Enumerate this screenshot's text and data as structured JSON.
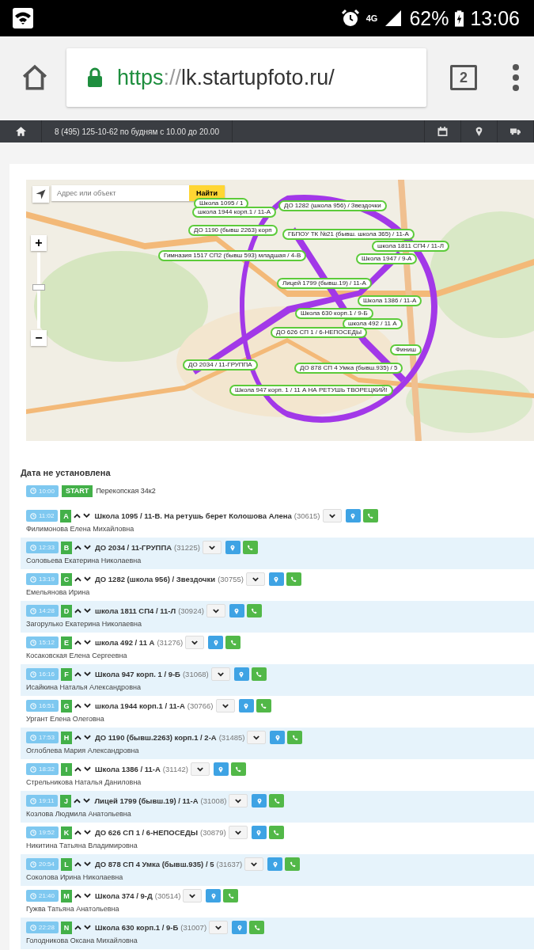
{
  "status_bar": {
    "battery": "62%",
    "time": "13:06",
    "network": "4G"
  },
  "browser": {
    "url_scheme": "https",
    "url_separator": "://",
    "url_host": "lk.startupfoto.ru/",
    "tab_count": "2"
  },
  "site_nav": {
    "phone": "8 (495) 125-10-62 по будням с 10.00 до 20.00"
  },
  "map": {
    "search": {
      "placeholder": "Адрес или объект",
      "button": "Найти"
    },
    "zoom_in": "+",
    "zoom_out": "−",
    "zoom_level": {
      "level": 0.55
    },
    "markers": [
      {
        "label": "Школа 1095 / 1"
      },
      {
        "label": "ДО 1282 (школа 956) / Звездочки"
      },
      {
        "label": "школа 1944 корп.1 / 11-А"
      },
      {
        "label": "ДО 1190 (бывш 2263) корп"
      },
      {
        "label": "ГБПОУ ТК №21 (бывш. школа 365) / 11-А"
      },
      {
        "label": "школа 1811 СП4 / 11-Л"
      },
      {
        "label": "Гимназия 1517 СП2 (бывш 593) младшая / 4-В"
      },
      {
        "label": "Школа 1947 / 9-А"
      },
      {
        "label": "Лицей 1799 (бывш.19) / 11-А"
      },
      {
        "label": "Школа 1386 / 11-А"
      },
      {
        "label": "Школа 630 корп.1 / 9-Б"
      },
      {
        "label": "школа 492 / 11 А"
      },
      {
        "label": "ДО 626 СП 1 / 6-НЕПОСЕДЫ"
      },
      {
        "label": "Финиш"
      },
      {
        "label": "ДО 2034 / 11-ГРУППА"
      },
      {
        "label": "ДО 878 СП 4 Умка (бывш.935) / 5"
      },
      {
        "label": "Школа 947 корп. 1 / 11 А НА РЕТУШЬ ТВОРЕЦКИЙ!"
      }
    ]
  },
  "schedule": {
    "heading": "Дата не установлена",
    "start": {
      "time": "10:00",
      "badge": "START",
      "address": "Перекопская 34к2"
    },
    "stops": [
      {
        "time": "11:02",
        "letter": "A",
        "title": "Школа 1095 / 11-В. На ретушь берет Колошова Алена",
        "code": "(30615)",
        "contact": "Филимонова Елена Михайловна"
      },
      {
        "time": "12:33",
        "letter": "B",
        "title": "ДО 2034 / 11-ГРУППА",
        "code": "(31225)",
        "contact": "Соловьева Екатерина Николаевна"
      },
      {
        "time": "13:19",
        "letter": "C",
        "title": "ДО 1282 (школа 956) / Звездочки",
        "code": "(30755)",
        "contact": "Емельянова Ирина"
      },
      {
        "time": "14:28",
        "letter": "D",
        "title": "школа 1811 СП4 / 11-Л",
        "code": "(30924)",
        "contact": "Загорулько Екатерина Николаевна"
      },
      {
        "time": "15:12",
        "letter": "E",
        "title": "школа 492 / 11 А",
        "code": "(31276)",
        "contact": "Косаковская Елена Сергеевна"
      },
      {
        "time": "16:16",
        "letter": "F",
        "title": "Школа 947 корп. 1 / 9-Б",
        "code": "(31068)",
        "contact": "Исайкина Наталья Александровна"
      },
      {
        "time": "16:51",
        "letter": "G",
        "title": "школа 1944 корп.1 / 11-А",
        "code": "(30766)",
        "contact": "Ургант Елена Олеговна"
      },
      {
        "time": "17:53",
        "letter": "H",
        "title": "ДО 1190 (бывш.2263) корп.1 / 2-А",
        "code": "(31485)",
        "contact": "Оглоблева Мария Александровна"
      },
      {
        "time": "18:32",
        "letter": "I",
        "title": "Школа 1386 / 11-А",
        "code": "(31142)",
        "contact": "Стрельникова Наталья Даниловна"
      },
      {
        "time": "19:11",
        "letter": "J",
        "title": "Лицей 1799 (бывш.19) / 11-А",
        "code": "(31008)",
        "contact": "Козлова Людмила Анатольевна"
      },
      {
        "time": "19:52",
        "letter": "K",
        "title": "ДО 626 СП 1 / 6-НЕПОСЕДЫ",
        "code": "(30879)",
        "contact": "Никитина Татьяна Владимировна"
      },
      {
        "time": "20:54",
        "letter": "L",
        "title": "ДО 878 СП 4 Умка (бывш.935) / 5",
        "code": "(31637)",
        "contact": "Соколова Ирина Николаевна"
      },
      {
        "time": "21:40",
        "letter": "M",
        "title": "Школа 374 / 9-Д",
        "code": "(30514)",
        "contact": "Гужва Татьяна Анатольевна"
      },
      {
        "time": "22:28",
        "letter": "N",
        "title": "Школа 630 корп.1 / 9-Б",
        "code": "(31007)",
        "contact": "Голодникова Оксана Михайловна"
      }
    ]
  }
}
